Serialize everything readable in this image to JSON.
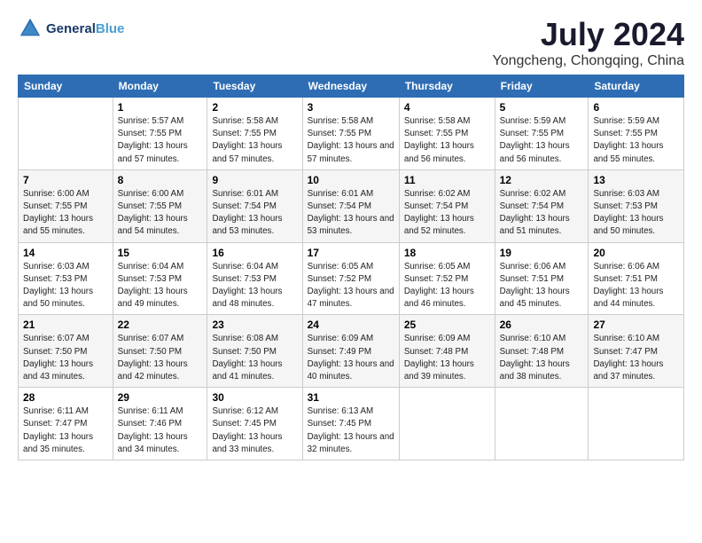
{
  "logo": {
    "line1": "General",
    "line2": "Blue"
  },
  "title": "July 2024",
  "subtitle": "Yongcheng, Chongqing, China",
  "weekdays": [
    "Sunday",
    "Monday",
    "Tuesday",
    "Wednesday",
    "Thursday",
    "Friday",
    "Saturday"
  ],
  "weeks": [
    [
      {
        "day": "",
        "sunrise": "",
        "sunset": "",
        "daylight": ""
      },
      {
        "day": "1",
        "sunrise": "Sunrise: 5:57 AM",
        "sunset": "Sunset: 7:55 PM",
        "daylight": "Daylight: 13 hours and 57 minutes."
      },
      {
        "day": "2",
        "sunrise": "Sunrise: 5:58 AM",
        "sunset": "Sunset: 7:55 PM",
        "daylight": "Daylight: 13 hours and 57 minutes."
      },
      {
        "day": "3",
        "sunrise": "Sunrise: 5:58 AM",
        "sunset": "Sunset: 7:55 PM",
        "daylight": "Daylight: 13 hours and 57 minutes."
      },
      {
        "day": "4",
        "sunrise": "Sunrise: 5:58 AM",
        "sunset": "Sunset: 7:55 PM",
        "daylight": "Daylight: 13 hours and 56 minutes."
      },
      {
        "day": "5",
        "sunrise": "Sunrise: 5:59 AM",
        "sunset": "Sunset: 7:55 PM",
        "daylight": "Daylight: 13 hours and 56 minutes."
      },
      {
        "day": "6",
        "sunrise": "Sunrise: 5:59 AM",
        "sunset": "Sunset: 7:55 PM",
        "daylight": "Daylight: 13 hours and 55 minutes."
      }
    ],
    [
      {
        "day": "7",
        "sunrise": "Sunrise: 6:00 AM",
        "sunset": "Sunset: 7:55 PM",
        "daylight": "Daylight: 13 hours and 55 minutes."
      },
      {
        "day": "8",
        "sunrise": "Sunrise: 6:00 AM",
        "sunset": "Sunset: 7:55 PM",
        "daylight": "Daylight: 13 hours and 54 minutes."
      },
      {
        "day": "9",
        "sunrise": "Sunrise: 6:01 AM",
        "sunset": "Sunset: 7:54 PM",
        "daylight": "Daylight: 13 hours and 53 minutes."
      },
      {
        "day": "10",
        "sunrise": "Sunrise: 6:01 AM",
        "sunset": "Sunset: 7:54 PM",
        "daylight": "Daylight: 13 hours and 53 minutes."
      },
      {
        "day": "11",
        "sunrise": "Sunrise: 6:02 AM",
        "sunset": "Sunset: 7:54 PM",
        "daylight": "Daylight: 13 hours and 52 minutes."
      },
      {
        "day": "12",
        "sunrise": "Sunrise: 6:02 AM",
        "sunset": "Sunset: 7:54 PM",
        "daylight": "Daylight: 13 hours and 51 minutes."
      },
      {
        "day": "13",
        "sunrise": "Sunrise: 6:03 AM",
        "sunset": "Sunset: 7:53 PM",
        "daylight": "Daylight: 13 hours and 50 minutes."
      }
    ],
    [
      {
        "day": "14",
        "sunrise": "Sunrise: 6:03 AM",
        "sunset": "Sunset: 7:53 PM",
        "daylight": "Daylight: 13 hours and 50 minutes."
      },
      {
        "day": "15",
        "sunrise": "Sunrise: 6:04 AM",
        "sunset": "Sunset: 7:53 PM",
        "daylight": "Daylight: 13 hours and 49 minutes."
      },
      {
        "day": "16",
        "sunrise": "Sunrise: 6:04 AM",
        "sunset": "Sunset: 7:53 PM",
        "daylight": "Daylight: 13 hours and 48 minutes."
      },
      {
        "day": "17",
        "sunrise": "Sunrise: 6:05 AM",
        "sunset": "Sunset: 7:52 PM",
        "daylight": "Daylight: 13 hours and 47 minutes."
      },
      {
        "day": "18",
        "sunrise": "Sunrise: 6:05 AM",
        "sunset": "Sunset: 7:52 PM",
        "daylight": "Daylight: 13 hours and 46 minutes."
      },
      {
        "day": "19",
        "sunrise": "Sunrise: 6:06 AM",
        "sunset": "Sunset: 7:51 PM",
        "daylight": "Daylight: 13 hours and 45 minutes."
      },
      {
        "day": "20",
        "sunrise": "Sunrise: 6:06 AM",
        "sunset": "Sunset: 7:51 PM",
        "daylight": "Daylight: 13 hours and 44 minutes."
      }
    ],
    [
      {
        "day": "21",
        "sunrise": "Sunrise: 6:07 AM",
        "sunset": "Sunset: 7:50 PM",
        "daylight": "Daylight: 13 hours and 43 minutes."
      },
      {
        "day": "22",
        "sunrise": "Sunrise: 6:07 AM",
        "sunset": "Sunset: 7:50 PM",
        "daylight": "Daylight: 13 hours and 42 minutes."
      },
      {
        "day": "23",
        "sunrise": "Sunrise: 6:08 AM",
        "sunset": "Sunset: 7:50 PM",
        "daylight": "Daylight: 13 hours and 41 minutes."
      },
      {
        "day": "24",
        "sunrise": "Sunrise: 6:09 AM",
        "sunset": "Sunset: 7:49 PM",
        "daylight": "Daylight: 13 hours and 40 minutes."
      },
      {
        "day": "25",
        "sunrise": "Sunrise: 6:09 AM",
        "sunset": "Sunset: 7:48 PM",
        "daylight": "Daylight: 13 hours and 39 minutes."
      },
      {
        "day": "26",
        "sunrise": "Sunrise: 6:10 AM",
        "sunset": "Sunset: 7:48 PM",
        "daylight": "Daylight: 13 hours and 38 minutes."
      },
      {
        "day": "27",
        "sunrise": "Sunrise: 6:10 AM",
        "sunset": "Sunset: 7:47 PM",
        "daylight": "Daylight: 13 hours and 37 minutes."
      }
    ],
    [
      {
        "day": "28",
        "sunrise": "Sunrise: 6:11 AM",
        "sunset": "Sunset: 7:47 PM",
        "daylight": "Daylight: 13 hours and 35 minutes."
      },
      {
        "day": "29",
        "sunrise": "Sunrise: 6:11 AM",
        "sunset": "Sunset: 7:46 PM",
        "daylight": "Daylight: 13 hours and 34 minutes."
      },
      {
        "day": "30",
        "sunrise": "Sunrise: 6:12 AM",
        "sunset": "Sunset: 7:45 PM",
        "daylight": "Daylight: 13 hours and 33 minutes."
      },
      {
        "day": "31",
        "sunrise": "Sunrise: 6:13 AM",
        "sunset": "Sunset: 7:45 PM",
        "daylight": "Daylight: 13 hours and 32 minutes."
      },
      {
        "day": "",
        "sunrise": "",
        "sunset": "",
        "daylight": ""
      },
      {
        "day": "",
        "sunrise": "",
        "sunset": "",
        "daylight": ""
      },
      {
        "day": "",
        "sunrise": "",
        "sunset": "",
        "daylight": ""
      }
    ]
  ]
}
